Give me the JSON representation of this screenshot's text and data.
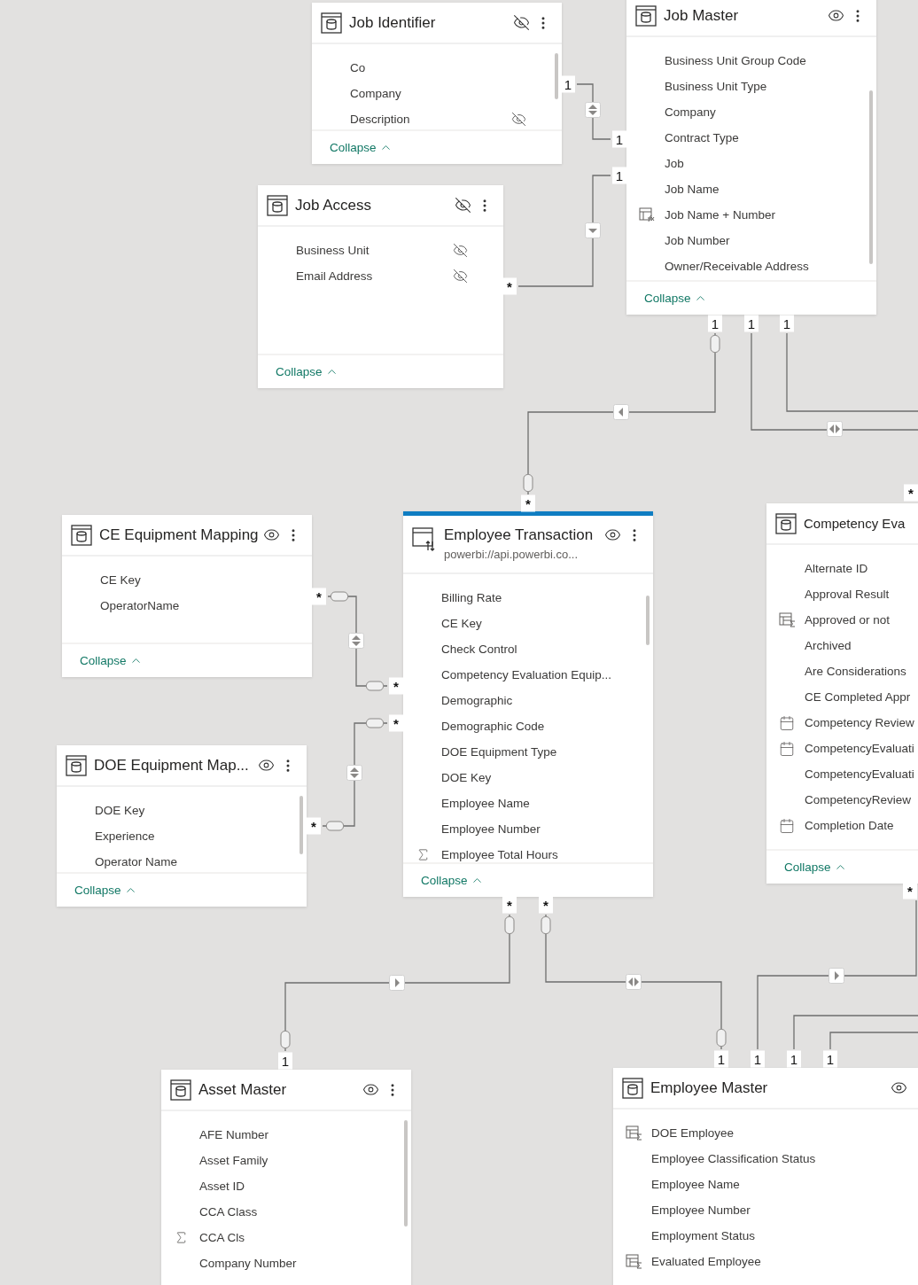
{
  "tables": [
    {
      "name": "Job Identifier",
      "kind": "table",
      "selected": false,
      "hidden": true,
      "collapse": "Collapse",
      "fields": [
        {
          "name": "Co",
          "kind": "column",
          "hidden": false
        },
        {
          "name": "Company",
          "kind": "column",
          "hidden": false
        },
        {
          "name": "Description",
          "kind": "column",
          "hidden": true
        }
      ]
    },
    {
      "name": "Job Master",
      "kind": "table",
      "selected": false,
      "hidden": false,
      "collapse": "Collapse",
      "fields": [
        {
          "name": "Business Unit Group Code",
          "kind": "column"
        },
        {
          "name": "Business Unit Type",
          "kind": "column"
        },
        {
          "name": "Company",
          "kind": "column"
        },
        {
          "name": "Contract Type",
          "kind": "column"
        },
        {
          "name": "Job",
          "kind": "column"
        },
        {
          "name": "Job Name",
          "kind": "column"
        },
        {
          "name": "Job Name + Number",
          "kind": "calc-column"
        },
        {
          "name": "Job Number",
          "kind": "column"
        },
        {
          "name": "Owner/Receivable Address",
          "kind": "column"
        }
      ]
    },
    {
      "name": "Job Access",
      "kind": "table",
      "selected": false,
      "hidden": true,
      "collapse": "Collapse",
      "fields": [
        {
          "name": "Business Unit",
          "kind": "column",
          "hidden": true
        },
        {
          "name": "Email Address",
          "kind": "column",
          "hidden": true
        }
      ]
    },
    {
      "name": "CE Equipment Mapping",
      "kind": "table",
      "selected": false,
      "hidden": false,
      "collapse": "Collapse",
      "fields": [
        {
          "name": "CE Key",
          "kind": "column"
        },
        {
          "name": "OperatorName",
          "kind": "column"
        }
      ]
    },
    {
      "name": "DOE Equipment Map...",
      "kind": "table",
      "selected": false,
      "hidden": false,
      "collapse": "Collapse",
      "fields": [
        {
          "name": "DOE Key",
          "kind": "column"
        },
        {
          "name": "Experience",
          "kind": "column"
        },
        {
          "name": "Operator Name",
          "kind": "column"
        }
      ]
    },
    {
      "name": "Employee Transaction",
      "subtitle": "powerbi://api.powerbi.co...",
      "kind": "directquery",
      "selected": true,
      "hidden": false,
      "collapse": "Collapse",
      "fields": [
        {
          "name": "Billing Rate",
          "kind": "column"
        },
        {
          "name": "CE Key",
          "kind": "column"
        },
        {
          "name": "Check Control",
          "kind": "column"
        },
        {
          "name": "Competency Evaluation Equip...",
          "kind": "column"
        },
        {
          "name": "Demographic",
          "kind": "column"
        },
        {
          "name": "Demographic Code",
          "kind": "column"
        },
        {
          "name": "DOE Equipment Type",
          "kind": "column"
        },
        {
          "name": "DOE Key",
          "kind": "column"
        },
        {
          "name": "Employee Name",
          "kind": "column"
        },
        {
          "name": "Employee Number",
          "kind": "column"
        },
        {
          "name": "Employee Total Hours",
          "kind": "sum"
        }
      ]
    },
    {
      "name": "Competency Eva",
      "kind": "table",
      "selected": false,
      "collapse": "Collapse",
      "fields": [
        {
          "name": "Alternate ID",
          "kind": "column"
        },
        {
          "name": "Approval Result",
          "kind": "column"
        },
        {
          "name": "Approved or not",
          "kind": "measure"
        },
        {
          "name": "Archived",
          "kind": "column"
        },
        {
          "name": "Are Considerations",
          "kind": "column"
        },
        {
          "name": "CE Completed Appr",
          "kind": "column"
        },
        {
          "name": "Competency Review",
          "kind": "date"
        },
        {
          "name": "CompetencyEvaluati",
          "kind": "date"
        },
        {
          "name": "CompetencyEvaluati",
          "kind": "column"
        },
        {
          "name": "CompetencyReview",
          "kind": "column"
        },
        {
          "name": "Completion Date",
          "kind": "date"
        }
      ]
    },
    {
      "name": "Asset Master",
      "kind": "table",
      "selected": false,
      "hidden": false,
      "fields": [
        {
          "name": "AFE Number",
          "kind": "column"
        },
        {
          "name": "Asset Family",
          "kind": "column"
        },
        {
          "name": "Asset ID",
          "kind": "column"
        },
        {
          "name": "CCA Class",
          "kind": "column"
        },
        {
          "name": "CCA Cls",
          "kind": "sum"
        },
        {
          "name": "Company Number",
          "kind": "column"
        }
      ]
    },
    {
      "name": "Employee Master",
      "kind": "table",
      "selected": false,
      "hidden": false,
      "fields": [
        {
          "name": "DOE Employee",
          "kind": "measure"
        },
        {
          "name": "Employee Classification Status",
          "kind": "column"
        },
        {
          "name": "Employee Name",
          "kind": "column"
        },
        {
          "name": "Employee Number",
          "kind": "column"
        },
        {
          "name": "Employment Status",
          "kind": "column"
        },
        {
          "name": "Evaluated Employee",
          "kind": "measure"
        }
      ]
    }
  ],
  "relationships": [
    {
      "ends": [
        "1",
        "1"
      ],
      "kind": "bidirectional",
      "ovals": false
    },
    {
      "ends": [
        "*",
        "1"
      ],
      "kind": "single",
      "ovals": false
    },
    {
      "ends": [
        "1",
        "*"
      ],
      "kind": "single",
      "ovals": true
    },
    {
      "ends": [
        "1"
      ],
      "kind": "bidirectional",
      "ovals": false
    },
    {
      "ends": [
        "1"
      ],
      "kind": "plain",
      "ovals": false
    },
    {
      "ends": [
        "*",
        "*"
      ],
      "kind": "bidirectional",
      "ovals": true
    },
    {
      "ends": [
        "*",
        "*"
      ],
      "kind": "bidirectional",
      "ovals": true
    },
    {
      "ends": [
        "*",
        "1"
      ],
      "kind": "single",
      "ovals": true
    },
    {
      "ends": [
        "*",
        "1"
      ],
      "kind": "bidirectional",
      "ovals": true
    },
    {
      "ends": [
        "1",
        "*"
      ],
      "kind": "single",
      "ovals": false
    },
    {
      "ends": [
        "1"
      ],
      "kind": "plain",
      "ovals": false
    },
    {
      "ends": [
        "1"
      ],
      "kind": "plain",
      "ovals": false
    },
    {
      "ends": [
        "*"
      ],
      "kind": "plain"
    }
  ]
}
